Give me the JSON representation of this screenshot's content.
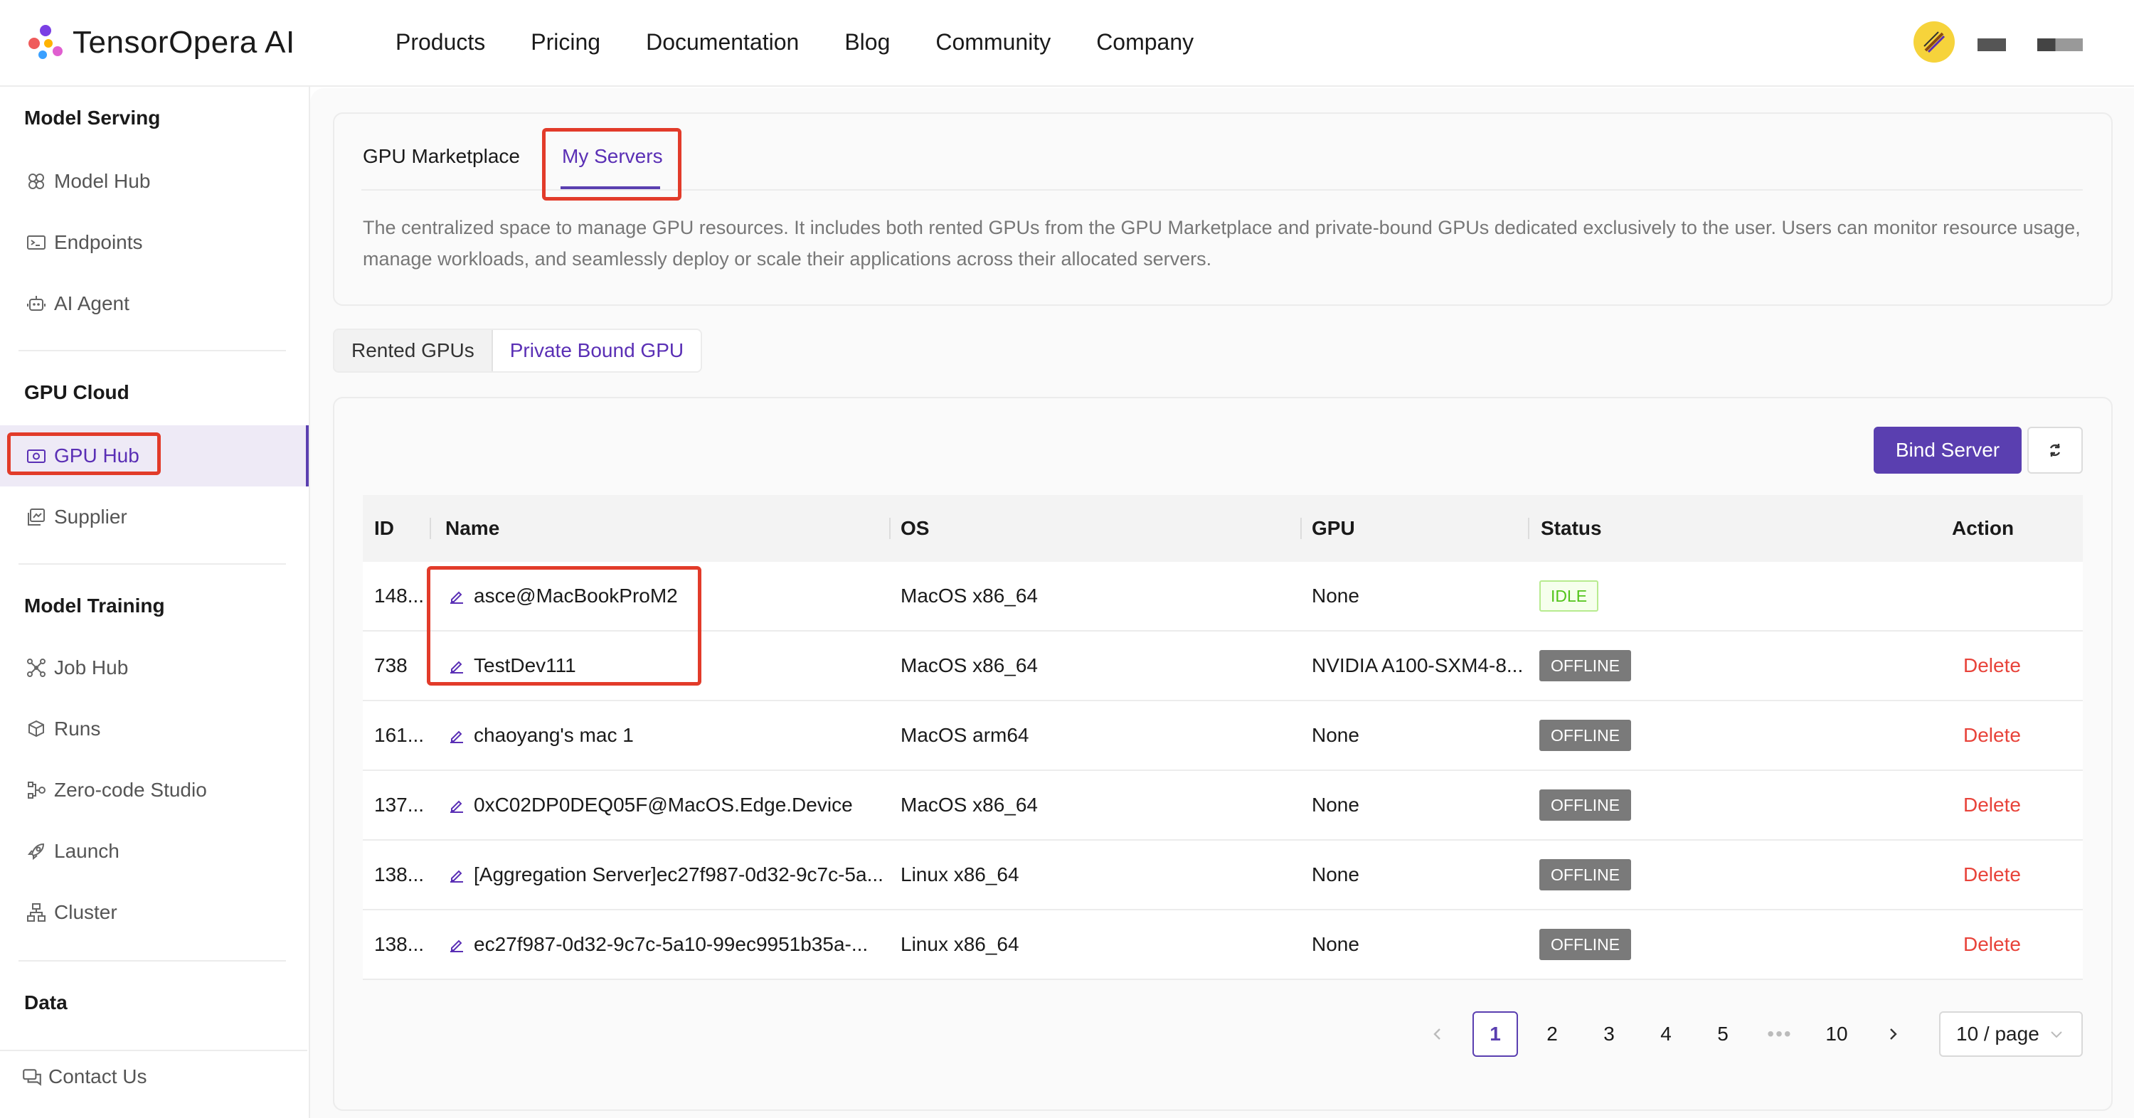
{
  "brand": {
    "name": "TensorOpera AI"
  },
  "topnav": {
    "links": [
      "Products",
      "Pricing",
      "Documentation",
      "Blog",
      "Community",
      "Company"
    ]
  },
  "sidebar": {
    "sections": [
      {
        "title": "Model Serving",
        "items": [
          "Model Hub",
          "Endpoints",
          "AI Agent"
        ]
      },
      {
        "title": "GPU Cloud",
        "items": [
          "GPU Hub",
          "Supplier"
        ]
      },
      {
        "title": "Model Training",
        "items": [
          "Job Hub",
          "Runs",
          "Zero-code Studio",
          "Launch",
          "Cluster"
        ]
      },
      {
        "title": "Data",
        "items": []
      }
    ],
    "active_item": "GPU Hub",
    "contact": "Contact Us"
  },
  "tabs": {
    "items": [
      "GPU Marketplace",
      "My Servers"
    ],
    "active": "My Servers"
  },
  "description": "The centralized space to manage GPU resources. It includes both rented GPUs from the GPU Marketplace and private-bound GPUs dedicated exclusively to the user. Users can monitor resource usage, manage workloads, and seamlessly deploy or scale their applications across their allocated servers.",
  "subtabs": {
    "items": [
      "Rented GPUs",
      "Private Bound GPU"
    ],
    "active": "Private Bound GPU"
  },
  "toolbar": {
    "bind_label": "Bind Server"
  },
  "table": {
    "headers": [
      "ID",
      "Name",
      "OS",
      "GPU",
      "Status",
      "Action"
    ],
    "rows": [
      {
        "id": "148...",
        "name": "asce@MacBookProM2",
        "os": "MacOS x86_64",
        "gpu": "None",
        "status": "IDLE",
        "action": ""
      },
      {
        "id": "738",
        "name": "TestDev111",
        "os": "MacOS x86_64",
        "gpu": "NVIDIA A100-SXM4-8...",
        "status": "OFFLINE",
        "action": "Delete"
      },
      {
        "id": "161...",
        "name": "chaoyang's mac 1",
        "os": "MacOS arm64",
        "gpu": "None",
        "status": "OFFLINE",
        "action": "Delete"
      },
      {
        "id": "137...",
        "name": "0xC02DP0DEQ05F@MacOS.Edge.Device",
        "os": "MacOS x86_64",
        "gpu": "None",
        "status": "OFFLINE",
        "action": "Delete"
      },
      {
        "id": "138...",
        "name": "[Aggregation Server]ec27f987-0d32-9c7c-5a...",
        "os": "Linux x86_64",
        "gpu": "None",
        "status": "OFFLINE",
        "action": "Delete"
      },
      {
        "id": "138...",
        "name": "ec27f987-0d32-9c7c-5a10-99ec9951b35a-...",
        "os": "Linux x86_64",
        "gpu": "None",
        "status": "OFFLINE",
        "action": "Delete"
      }
    ]
  },
  "pagination": {
    "pages": [
      "1",
      "2",
      "3",
      "4",
      "5",
      "•••",
      "10"
    ],
    "current": "1",
    "page_size": "10 / page"
  },
  "colors": {
    "accent": "#5a3fb0",
    "danger": "#e8433a",
    "highlight_box": "#e23b2a",
    "offline": "#7a7a7a",
    "idle": "#52c41a"
  }
}
